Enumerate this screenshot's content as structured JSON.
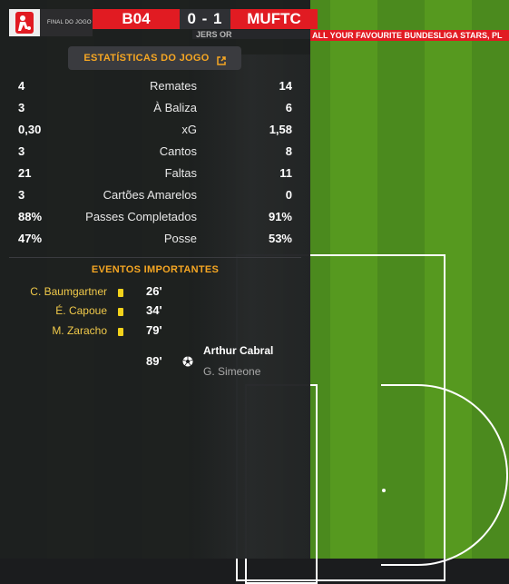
{
  "scoreboard": {
    "final_label": "FINAL DO JOGO",
    "home_team": "B04",
    "score": "0 - 1",
    "away_team": "MUFTC"
  },
  "ticker": {
    "left_fragment": "JERS OR",
    "text": "ALL YOUR FAVOURITE BUNDESLIGA STARS, PL"
  },
  "stats": {
    "header": "ESTATÍSTICAS DO JOGO",
    "rows": [
      {
        "home": "4",
        "label": "Remates",
        "away": "14"
      },
      {
        "home": "3",
        "label": "À Baliza",
        "away": "6"
      },
      {
        "home": "0,30",
        "label": "xG",
        "away": "1,58"
      },
      {
        "home": "3",
        "label": "Cantos",
        "away": "8"
      },
      {
        "home": "21",
        "label": "Faltas",
        "away": "11"
      },
      {
        "home": "3",
        "label": "Cartões Amarelos",
        "away": "0"
      },
      {
        "home": "88%",
        "label": "Passes Completados",
        "away": "91%"
      },
      {
        "home": "47%",
        "label": "Posse",
        "away": "53%"
      }
    ]
  },
  "events": {
    "title": "EVENTOS IMPORTANTES",
    "cards": [
      {
        "player": "C. Baumgartner",
        "minute": "26'"
      },
      {
        "player": "É. Capoue",
        "minute": "34'"
      },
      {
        "player": "M. Zaracho",
        "minute": "79'"
      }
    ],
    "goal": {
      "minute": "89'",
      "scorer": "Arthur Cabral",
      "assist": "G. Simeone"
    }
  },
  "colors": {
    "accent": "#f5a623",
    "team_red": "#e11b22",
    "yellow_card": "#f2d21b",
    "pitch_green": "#56991f"
  },
  "icons": {
    "league_logo": "bundesliga-logo-icon",
    "external": "external-link-icon",
    "card": "yellow-card-icon",
    "goal": "football-icon"
  }
}
